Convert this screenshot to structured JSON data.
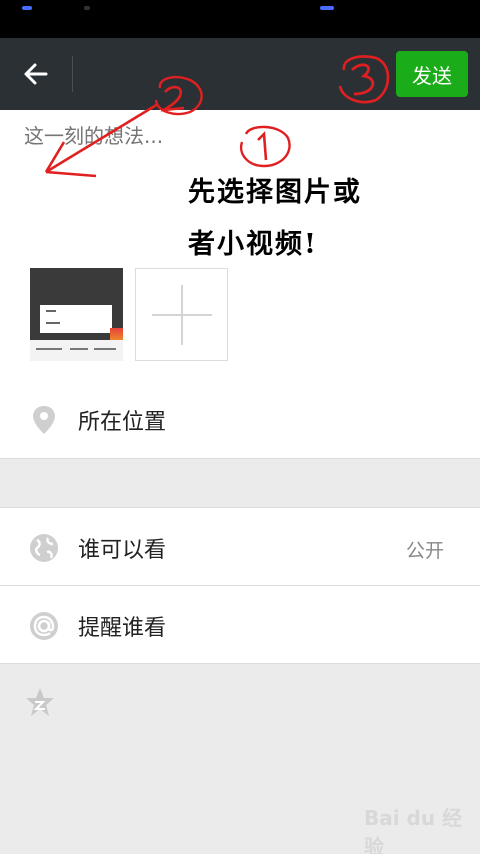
{
  "top_bar": {
    "send_label": "发送"
  },
  "compose": {
    "placeholder": "这一刻的想法..."
  },
  "annotations": {
    "circled_1": "①",
    "circled_2": "②",
    "circled_3": "③",
    "note_line1": "先选择图片或",
    "note_line2": "者小视频!"
  },
  "media": {
    "add_icon": "plus-icon",
    "thumb_icon": "image-thumbnail"
  },
  "rows": {
    "location": {
      "label": "所在位置",
      "icon": "location-pin-icon"
    },
    "visibility": {
      "label": "谁可以看",
      "value": "公开",
      "icon": "globe-icon"
    },
    "remind": {
      "label": "提醒谁看",
      "icon": "at-icon"
    }
  },
  "watermark": {
    "text": "Bai du 经验"
  },
  "colors": {
    "accent_green": "#1aad19",
    "annotation_red": "#e02020",
    "top_bar": "#2b3035"
  }
}
